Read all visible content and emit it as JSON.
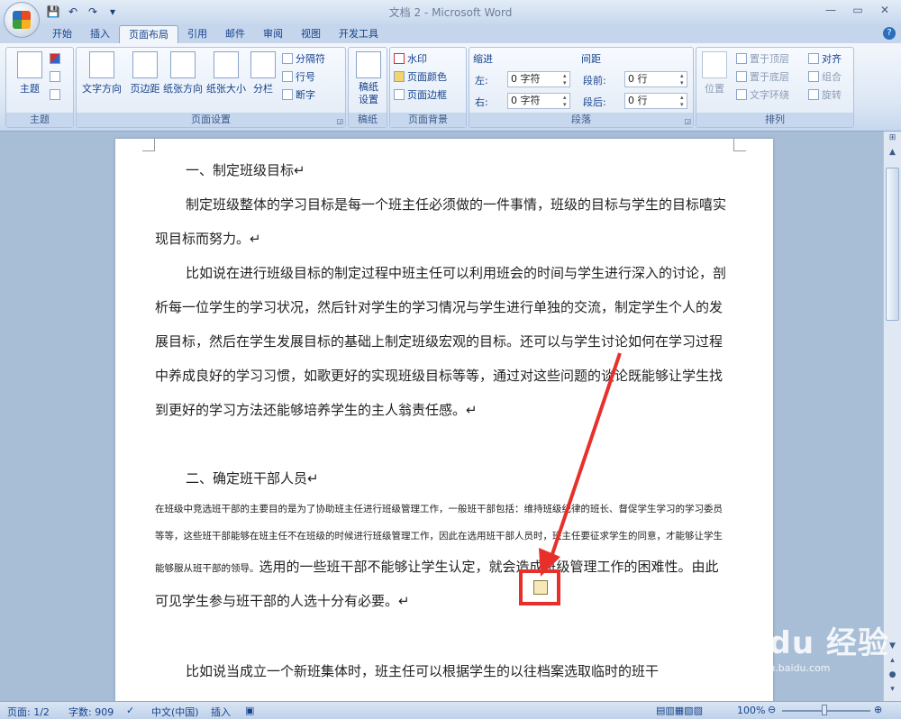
{
  "window": {
    "title": "文档 2 - Microsoft Word"
  },
  "qat": {
    "save": "💾",
    "undo": "↶",
    "redo": "↷",
    "more": "▾"
  },
  "tabs": [
    "开始",
    "插入",
    "页面布局",
    "引用",
    "邮件",
    "审阅",
    "视图",
    "开发工具"
  ],
  "active_tab": "页面布局",
  "ribbon": {
    "theme": {
      "btn": "主题",
      "group": "主题"
    },
    "pagesetup": {
      "text_dir": "文字方向",
      "margins": "页边距",
      "orientation": "纸张方向",
      "size": "纸张大小",
      "columns": "分栏",
      "breaks": "分隔符",
      "line_numbers": "行号",
      "hyphenation": "断字",
      "group": "页面设置"
    },
    "manuscript": {
      "btn": "稿纸设置",
      "group": "稿纸"
    },
    "background": {
      "watermark": "水印",
      "page_color": "页面颜色",
      "page_border": "页面边框",
      "group": "页面背景"
    },
    "paragraph": {
      "indent": "缩进",
      "left": "左:",
      "left_val": "0 字符",
      "right": "右:",
      "right_val": "0 字符",
      "spacing": "间距",
      "before": "段前:",
      "before_val": "0 行",
      "after": "段后:",
      "after_val": "0 行",
      "group": "段落"
    },
    "arrange": {
      "position": "位置",
      "bring_front": "置于顶层",
      "send_back": "置于底层",
      "wrap": "文字环绕",
      "align": "对齐",
      "group_btn": "组合",
      "rotate": "旋转",
      "group": "排列"
    }
  },
  "doc": {
    "h1": "一、制定班级目标↵",
    "p1": "制定班级整体的学习目标是每一个班主任必须做的一件事情，班级的目标与学生的目标嘻实现目标而努力。↵",
    "p2": "比如说在进行班级目标的制定过程中班主任可以利用班会的时间与学生进行深入的讨论，剖析每一位学生的学习状况，然后针对学生的学习情况与学生进行单独的交流，制定学生个人的发展目标，然后在学生发展目标的基础上制定班级宏观的目标。还可以与学生讨论如何在学习过程中养成良好的学习习惯，如歌更好的实现班级目标等等，通过对这些问题的谈论既能够让学生找到更好的学习方法还能够培养学生的主人翁责任感。↵",
    "h2": "二、确定班干部人员↵",
    "p3_small": "在班级中竞选班干部的主要目的是为了协助班主任进行班级管理工作，一般班干部包括：维持班级纪律的班长、督促学生学习的学习委员等等，这些班干部能够在班主任不在班级的时候进行班级管理工作，因此在选用班干部人员时，班主任要征求学生的同意，才能够让学生能够服从班干部的领导。",
    "p3_big": "选用的一些班干部不能够让学生认定，就会造成班级管理工作的困难性。由此可见学生参与班干部的人选十分有必要。↵",
    "p4": "比如说当成立一个新班集体时，班主任可以根据学生的以往档案选取临时的班干"
  },
  "status": {
    "page": "页面: 1/2",
    "words": "字数: 909",
    "lang": "中文(中国)",
    "mode": "插入",
    "zoom": "100%"
  },
  "watermark": {
    "brand": "Baidu 经验",
    "sub": "jingyan.baidu.com"
  }
}
